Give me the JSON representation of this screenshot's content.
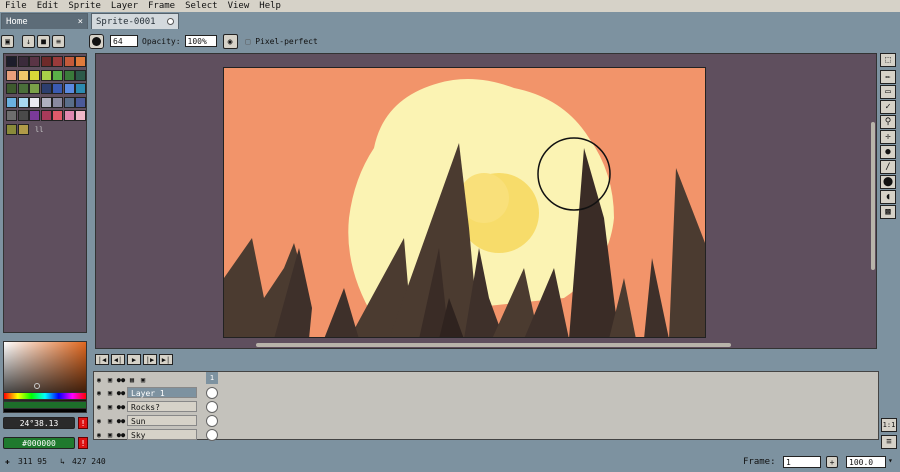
{
  "menu": [
    "File",
    "Edit",
    "Sprite",
    "Layer",
    "Frame",
    "Select",
    "View",
    "Help"
  ],
  "tabs": {
    "home": "Home",
    "home_close": "×",
    "sprite": "Sprite-0001"
  },
  "toolbar": {
    "brush_size": "64",
    "opacity_label": "Opacity:",
    "opacity_value": "100%",
    "pixel_perfect": "Pixel-perfect"
  },
  "palette": {
    "colors": [
      "#1d1d2b",
      "#3b2b3b",
      "#5a3445",
      "#6e2a2a",
      "#9a3b3b",
      "#c45a3a",
      "#e07b3b",
      "#e8a07b",
      "#f0c86a",
      "#d8d838",
      "#a8d048",
      "#5ab048",
      "#3a7a3a",
      "#2c5a4a",
      "#3e5a2e",
      "#4a6e3a",
      "#7aa048",
      "#2c3e6e",
      "#3a5ab0",
      "#5a8ae0",
      "#2c8ab0",
      "#6ab0e0",
      "#a8d8f0",
      "#e8e8f0",
      "#b0b0c0",
      "#8a8aa0",
      "#5a6e8a",
      "#4a5a9a",
      "#6e6e6e",
      "#4a4a4a",
      "#7a3a9a",
      "#a83a5a",
      "#e05a6a",
      "#e088b0",
      "#f0b8c8",
      "#8a8a3a",
      "#b09a48"
    ],
    "marker": "ll"
  },
  "color_picker": {
    "hsv": "24°38.13",
    "hex": "#000000",
    "warn": "!"
  },
  "timeline": {
    "frame_number": "1",
    "layers": [
      {
        "name": "Layer 1",
        "selected": true
      },
      {
        "name": "Rocks?",
        "selected": false
      },
      {
        "name": "Sun",
        "selected": false
      },
      {
        "name": "Sky",
        "selected": false
      }
    ]
  },
  "status": {
    "cursor": "311 95",
    "size": "427 240",
    "frame_label": "Frame:",
    "frame": "1",
    "zoom": "100.0"
  }
}
